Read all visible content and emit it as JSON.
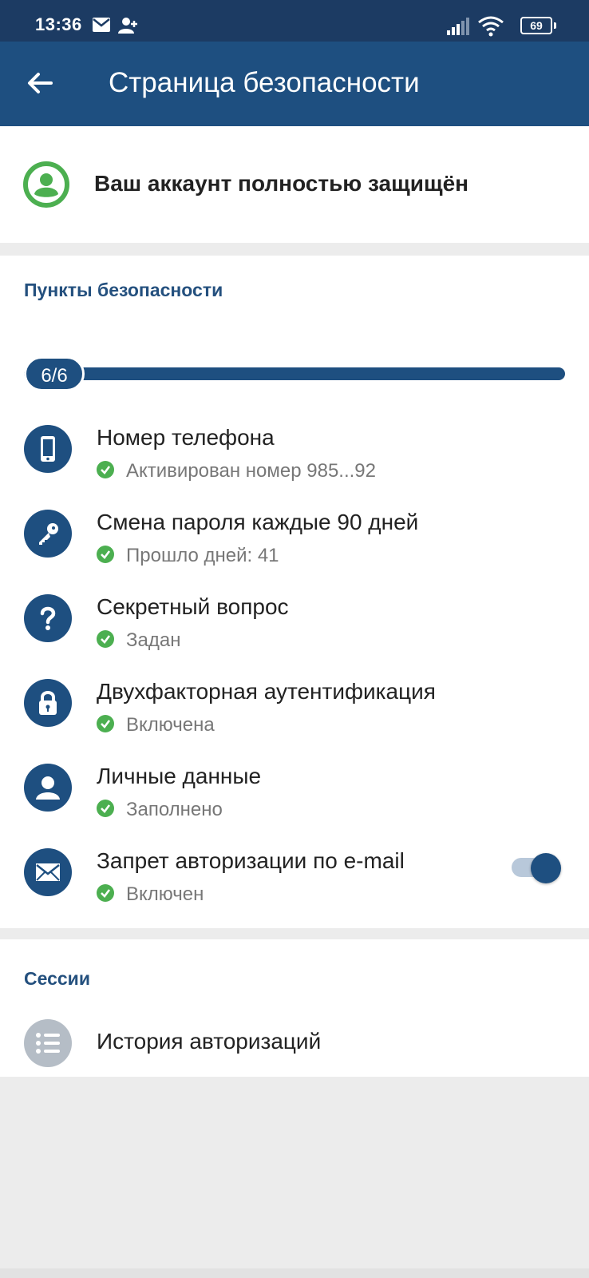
{
  "status": {
    "time": "13:36",
    "battery": "69"
  },
  "appbar": {
    "title": "Страница безопасности"
  },
  "protection": {
    "message": "Ваш аккаунт полностью защищён"
  },
  "points": {
    "section_title": "Пункты безопасности",
    "progress_label": "6/6",
    "progress_fraction": 1.0,
    "items": [
      {
        "title": "Номер телефона",
        "status": "Активирован номер 985...92",
        "icon": "phone-icon"
      },
      {
        "title": "Смена пароля каждые 90 дней",
        "status": "Прошло дней: 41",
        "icon": "key-icon"
      },
      {
        "title": "Секретный вопрос",
        "status": "Задан",
        "icon": "question-icon"
      },
      {
        "title": "Двухфакторная аутентификация",
        "status": "Включена",
        "icon": "lock-icon"
      },
      {
        "title": "Личные данные",
        "status": "Заполнено",
        "icon": "person-icon"
      },
      {
        "title": "Запрет авторизации по e-mail",
        "status": "Включен",
        "icon": "mail-icon",
        "toggle_on": true
      }
    ]
  },
  "sessions": {
    "section_title": "Сессии",
    "history_label": "История авторизаций",
    "icon": "list-icon"
  },
  "colors": {
    "statusbar": "#1c3b63",
    "appbar": "#1e4f80",
    "accent_green": "#4caf50",
    "section_title": "#24507e"
  }
}
